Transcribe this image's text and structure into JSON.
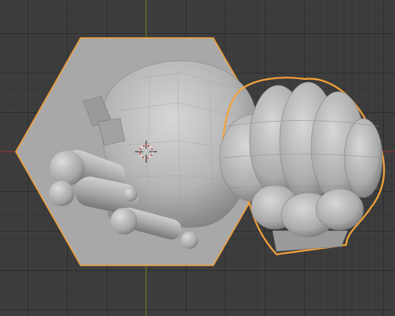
{
  "app": "3D Viewport",
  "scene": {
    "selection_outline": "orange",
    "objects": [
      {
        "name": "hexagon-plane",
        "selected": true
      },
      {
        "name": "sculpt-body",
        "selected": false
      },
      {
        "name": "sculpt-fist",
        "selected": true
      }
    ]
  },
  "colors": {
    "background": "#3d3d3d",
    "grid": "#353535",
    "x_axis": "#8a3a3a",
    "y_axis": "#5f7a2e",
    "selection": "#f2a13a",
    "mesh": "#b9b9b9",
    "plane": "#a8a8a8"
  },
  "cursor": {
    "icon": "3d-cursor-icon"
  }
}
